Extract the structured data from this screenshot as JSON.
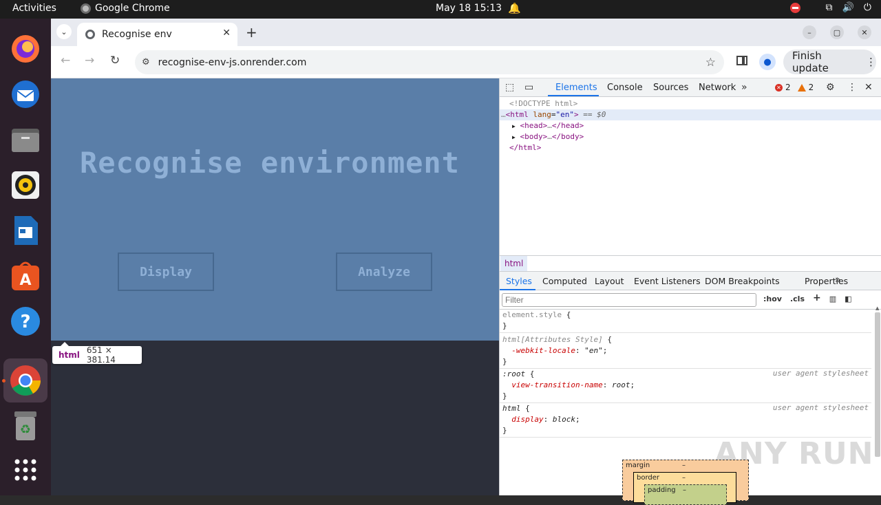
{
  "topbar": {
    "activities": "Activities",
    "app_name": "Google Chrome",
    "clock": "May 18  15:13"
  },
  "dock": {
    "apps": [
      "firefox-icon",
      "thunderbird-icon",
      "files-icon",
      "rhythmbox-icon",
      "writer-icon",
      "app-center-icon",
      "help-icon",
      "chrome-icon",
      "trash-icon",
      "app-grid-icon"
    ]
  },
  "browser": {
    "tab_title": "Recognise env",
    "url": "recognise-env-js.onrender.com",
    "finish_update": "Finish update"
  },
  "page": {
    "title": "Recognise environment",
    "display_button": "Display",
    "analyze_button": "Analyze",
    "tooltip_tag": "html",
    "tooltip_size": "651 × 381.14",
    "bg_color": "#5a7ea8"
  },
  "devtools": {
    "tabs": [
      "Elements",
      "Console",
      "Sources",
      "Network"
    ],
    "errors": "2",
    "warnings": "2",
    "dom": {
      "doctype": "<!DOCTYPE html>",
      "html_open_tag": "<html",
      "html_attr_name": "lang",
      "html_attr_value": "\"en\"",
      "html_eq": "== $0",
      "head": "<head>",
      "head_close": "</head>",
      "body": "<body>",
      "body_close": "</body>",
      "html_close": "</html>",
      "ellipsis": "…"
    },
    "breadcrumb": "html",
    "sub_tabs": [
      "Styles",
      "Computed",
      "Layout",
      "Event Listeners",
      "DOM Breakpoints",
      "Properties"
    ],
    "filter_placeholder": "Filter",
    "filter_tools": [
      ":hov",
      ".cls"
    ],
    "rules": {
      "element_style": "element.style",
      "attr_style": "html[Attributes Style]",
      "webkit_prop": "-webkit-locale",
      "webkit_val": "\"en\"",
      "root_sel": ":root",
      "vt_prop": "view-transition-name",
      "vt_val": "root",
      "html_sel": "html",
      "display_prop": "display",
      "display_val": "block",
      "ua_label": "user agent stylesheet"
    },
    "box_model": {
      "margin": "margin",
      "border": "border",
      "padding": "padding",
      "dash": "–"
    }
  },
  "watermark": "ANY RUN"
}
